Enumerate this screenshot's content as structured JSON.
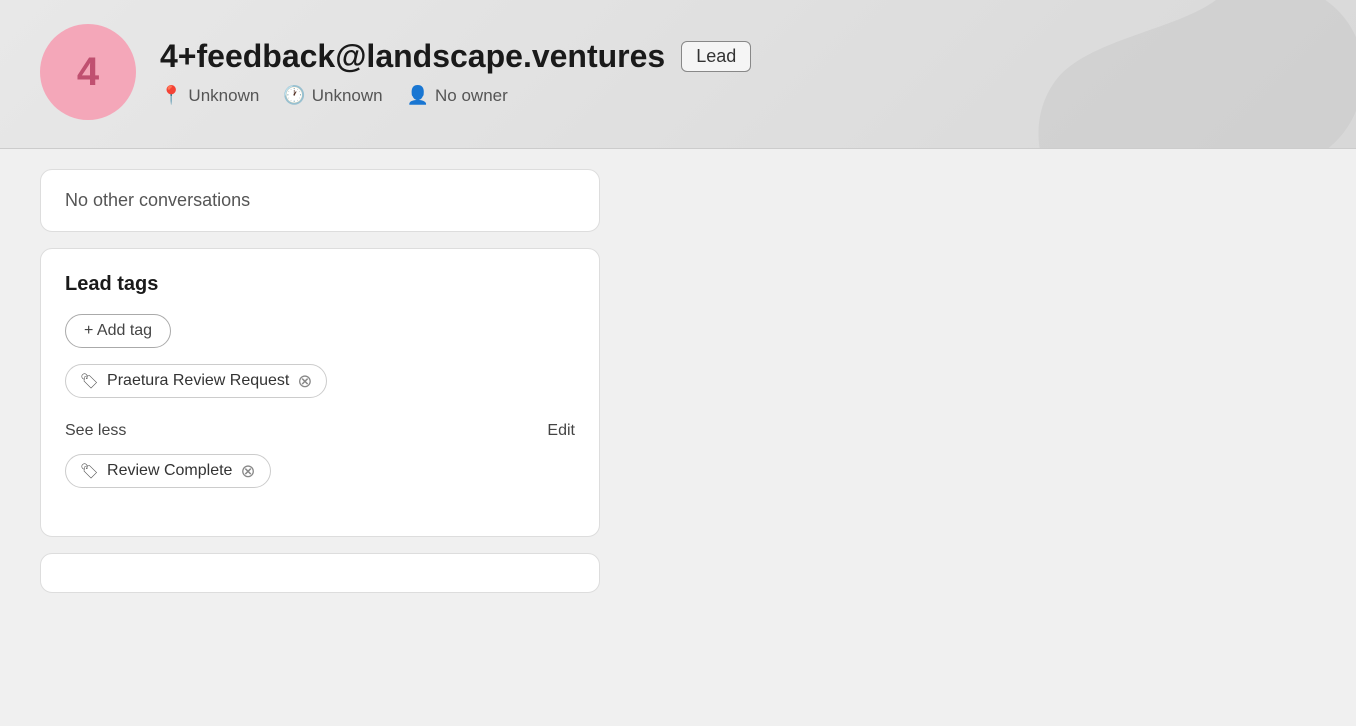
{
  "header": {
    "avatar_number": "4",
    "email": "4+feedback@landscape.ventures",
    "lead_badge": "Lead",
    "meta": {
      "location_icon": "📍",
      "location": "Unknown",
      "time_icon": "🕐",
      "time": "Unknown",
      "owner_icon": "👤",
      "owner": "No owner"
    }
  },
  "conversations": {
    "empty_text": "No other conversations"
  },
  "lead_tags": {
    "title": "Lead tags",
    "add_tag_label": "+ Add tag",
    "tags": [
      {
        "label": "Praetura Review Request"
      },
      {
        "label": "Review Complete"
      }
    ],
    "see_less_label": "See less",
    "edit_label": "Edit"
  }
}
